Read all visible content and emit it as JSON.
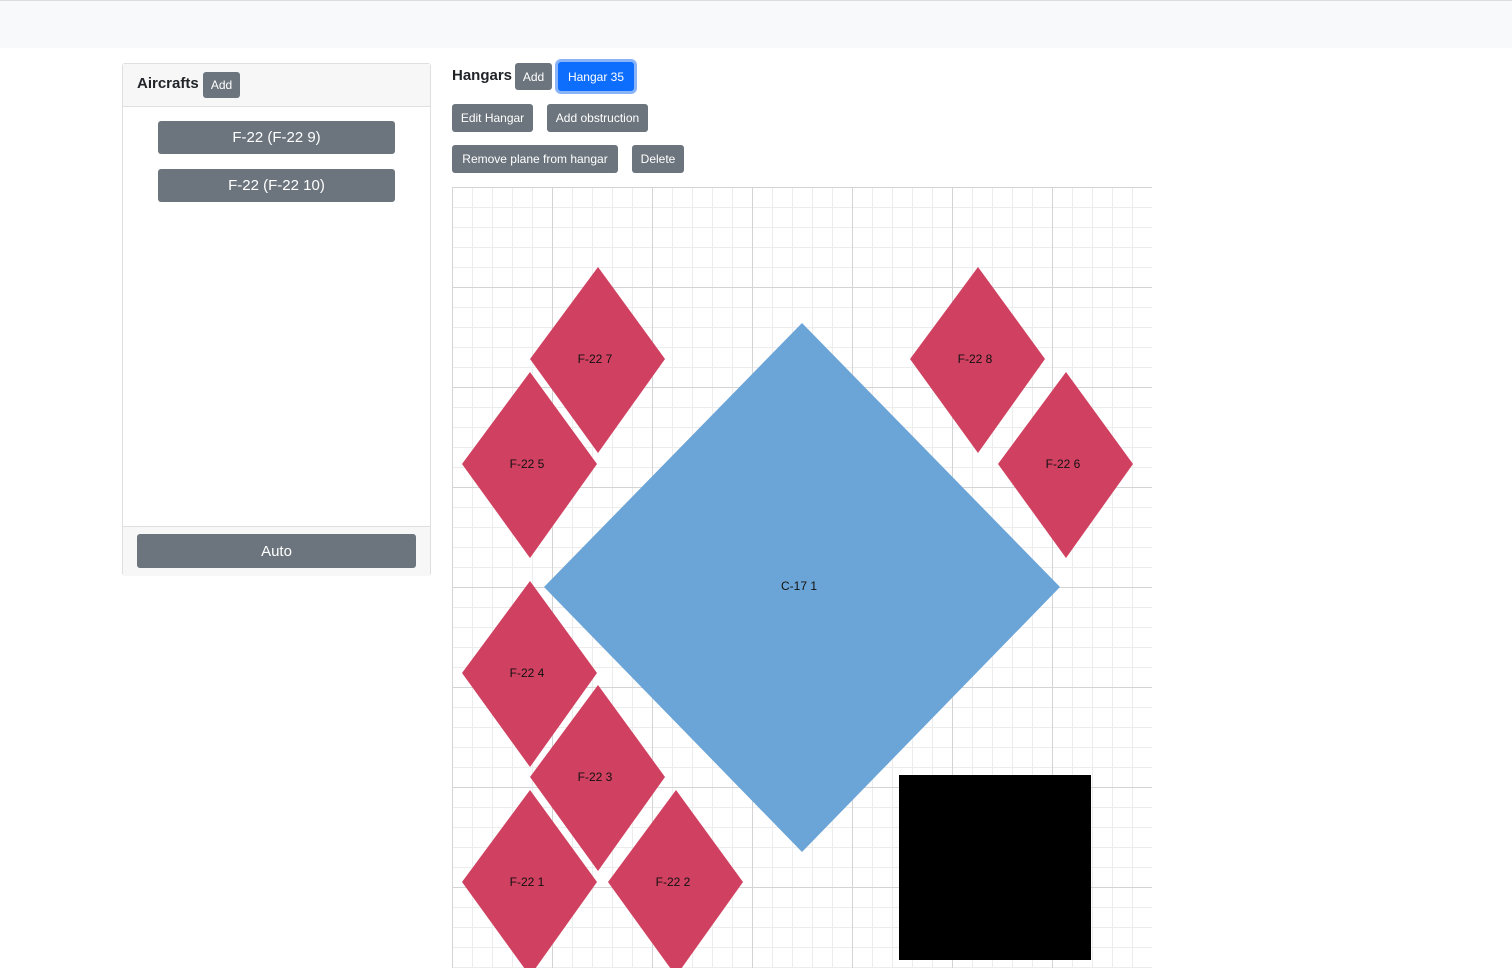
{
  "aircrafts_panel": {
    "title": "Aircrafts",
    "add_label": "Add",
    "items": [
      {
        "label": "F-22 (F-22 9)"
      },
      {
        "label": "F-22 (F-22 10)"
      }
    ],
    "auto_label": "Auto"
  },
  "hangars": {
    "title": "Hangars",
    "add_label": "Add",
    "selected_label": "Hangar 35",
    "edit_label": "Edit Hangar",
    "add_obstruction_label": "Add obstruction",
    "remove_plane_label": "Remove plane from hangar",
    "delete_label": "Delete"
  },
  "planes": [
    {
      "label": "F-22 7",
      "color": "#d04060"
    },
    {
      "label": "F-22 8",
      "color": "#d04060"
    },
    {
      "label": "F-22 5",
      "color": "#d04060"
    },
    {
      "label": "F-22 6",
      "color": "#d04060"
    },
    {
      "label": "C-17 1",
      "color": "#6ba4d6"
    },
    {
      "label": "F-22 4",
      "color": "#d04060"
    },
    {
      "label": "F-22 3",
      "color": "#d04060"
    },
    {
      "label": "F-22 1",
      "color": "#d04060"
    },
    {
      "label": "F-22 2",
      "color": "#d04060"
    }
  ],
  "obstruction": {
    "color": "#000000"
  },
  "colors": {
    "secondary_button": "#6c757d",
    "primary_button": "#0d6efd",
    "fighter": "#d04060",
    "transport": "#6ba4d6"
  }
}
